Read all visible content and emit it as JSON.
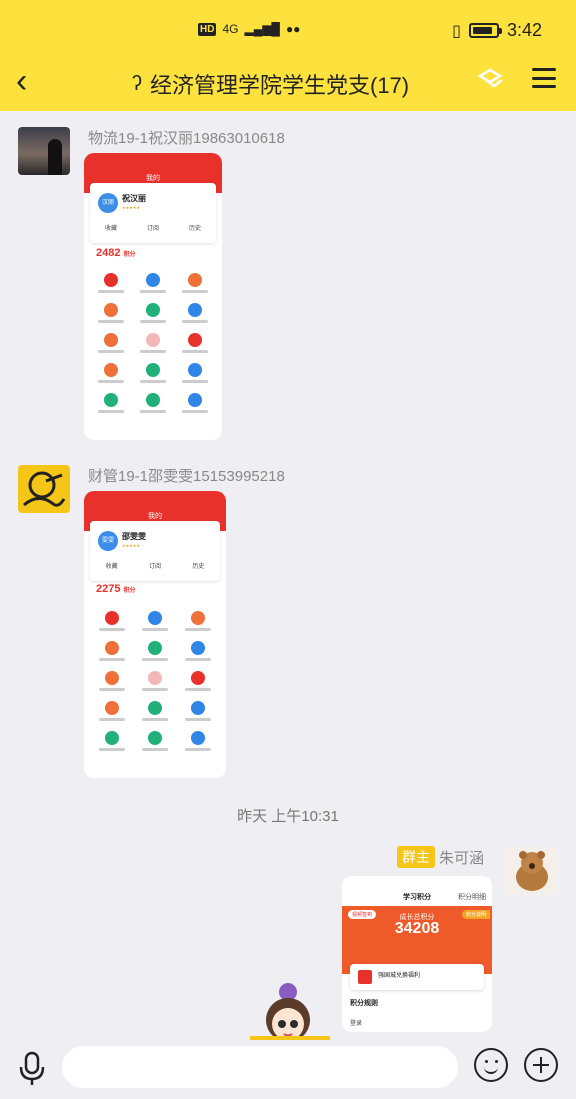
{
  "status_bar": {
    "network": "4G",
    "time": "3:42"
  },
  "header": {
    "title": "经济管理学院学生党支(17)"
  },
  "messages": [
    {
      "sender": "物流19-1祝汉丽19863010618",
      "screenshot": {
        "page_title": "我的",
        "user_name": "祝汉丽",
        "avatar_text": "汉丽",
        "actions": [
          "收藏",
          "订阅",
          "历史"
        ],
        "points": "2482",
        "points_unit": "积分"
      }
    },
    {
      "sender": "财管19-1邵雯雯15153995218",
      "screenshot": {
        "page_title": "我的",
        "user_name": "邵雯雯",
        "avatar_text": "雯雯",
        "actions": [
          "收藏",
          "订阅",
          "历史"
        ],
        "points": "2275",
        "points_unit": "积分"
      }
    }
  ],
  "timestamp": "昨天 上午10:31",
  "owner_message": {
    "badge": "群主",
    "sender": "朱可涵",
    "screenshot": {
      "page_title": "学习积分",
      "right_link": "积分明细",
      "label": "成长总积分",
      "score": "34208",
      "pill_left": "视频签到",
      "pill_right": "积分说明",
      "card_text": "强国城兑换福利",
      "rules": "积分规则",
      "sub": "登录"
    }
  },
  "colors": {
    "header_bg": "#fde13d",
    "chat_bg": "#efeff3",
    "owner_badge": "#f5c518",
    "app_red": "#e8312b"
  }
}
